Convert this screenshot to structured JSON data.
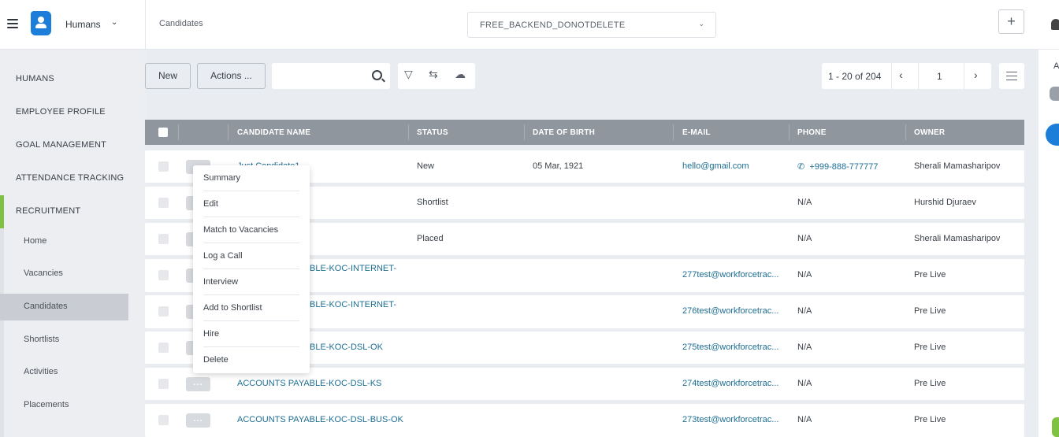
{
  "app": {
    "name": "Humans",
    "page_title": "Candidates"
  },
  "tenant": {
    "value": "FREE_BACKEND_DONOTDELETE"
  },
  "topbar": {
    "plus": "+",
    "right_letter": "A"
  },
  "sidebar": {
    "sections": [
      "HUMANS",
      "EMPLOYEE PROFILE",
      "GOAL MANAGEMENT",
      "ATTENDANCE TRACKING",
      "RECRUITMENT"
    ],
    "recruitment_items": [
      "Home",
      "Vacancies",
      "Candidates",
      "Shortlists",
      "Activities",
      "Placements"
    ],
    "active": "Candidates"
  },
  "toolbar": {
    "new_label": "New",
    "actions_label": "Actions ...",
    "search_placeholder": ""
  },
  "pager": {
    "range": "1 - 20 of 204",
    "page": "1"
  },
  "table": {
    "headers": [
      "CANDIDATE NAME",
      "STATUS",
      "DATE OF BIRTH",
      "E-MAIL",
      "PHONE",
      "OWNER"
    ],
    "rows": [
      {
        "name": "Just Candidate1",
        "status": "New",
        "dob": "05 Mar, 1921",
        "email": "hello@gmail.com",
        "phone": "+999-888-777777",
        "owner": "Sherali Mamasharipov"
      },
      {
        "name": "",
        "status": "Shortlist",
        "dob": "",
        "email": "",
        "phone": "N/A",
        "owner": "Hurshid Djuraev"
      },
      {
        "name": "",
        "status": "Placed",
        "dob": "",
        "email": "",
        "phone": "N/A",
        "owner": "Sherali Mamasharipov"
      },
      {
        "name": "BLE-KOC-INTERNET-",
        "status": "",
        "dob": "",
        "email": "277test@workforcetrac...",
        "phone": "N/A",
        "owner": "Pre Live"
      },
      {
        "name": "BLE-KOC-INTERNET-",
        "status": "",
        "dob": "",
        "email": "276test@workforcetrac...",
        "phone": "N/A",
        "owner": "Pre Live"
      },
      {
        "name": "BLE-KOC-DSL-OK",
        "status": "",
        "dob": "",
        "email": "275test@workforcetrac...",
        "phone": "N/A",
        "owner": "Pre Live"
      },
      {
        "name": "ACCOUNTS PAYABLE-KOC-DSL-KS",
        "status": "",
        "dob": "",
        "email": "274test@workforcetrac...",
        "phone": "N/A",
        "owner": "Pre Live"
      },
      {
        "name": "ACCOUNTS PAYABLE-KOC-DSL-BUS-OK",
        "status": "",
        "dob": "",
        "email": "273test@workforcetrac...",
        "phone": "N/A",
        "owner": "Pre Live"
      }
    ]
  },
  "row_menu": {
    "dots": "...",
    "items": [
      "Summary",
      "Edit",
      "Match to Vacancies",
      "Log a Call",
      "Interview",
      "Add to Shortlist",
      "Hire",
      "Delete"
    ]
  },
  "colors": {
    "accent": "#7fc241",
    "brand": "#1d7ed9",
    "link": "#1d6e93",
    "header": "#8f969e"
  }
}
